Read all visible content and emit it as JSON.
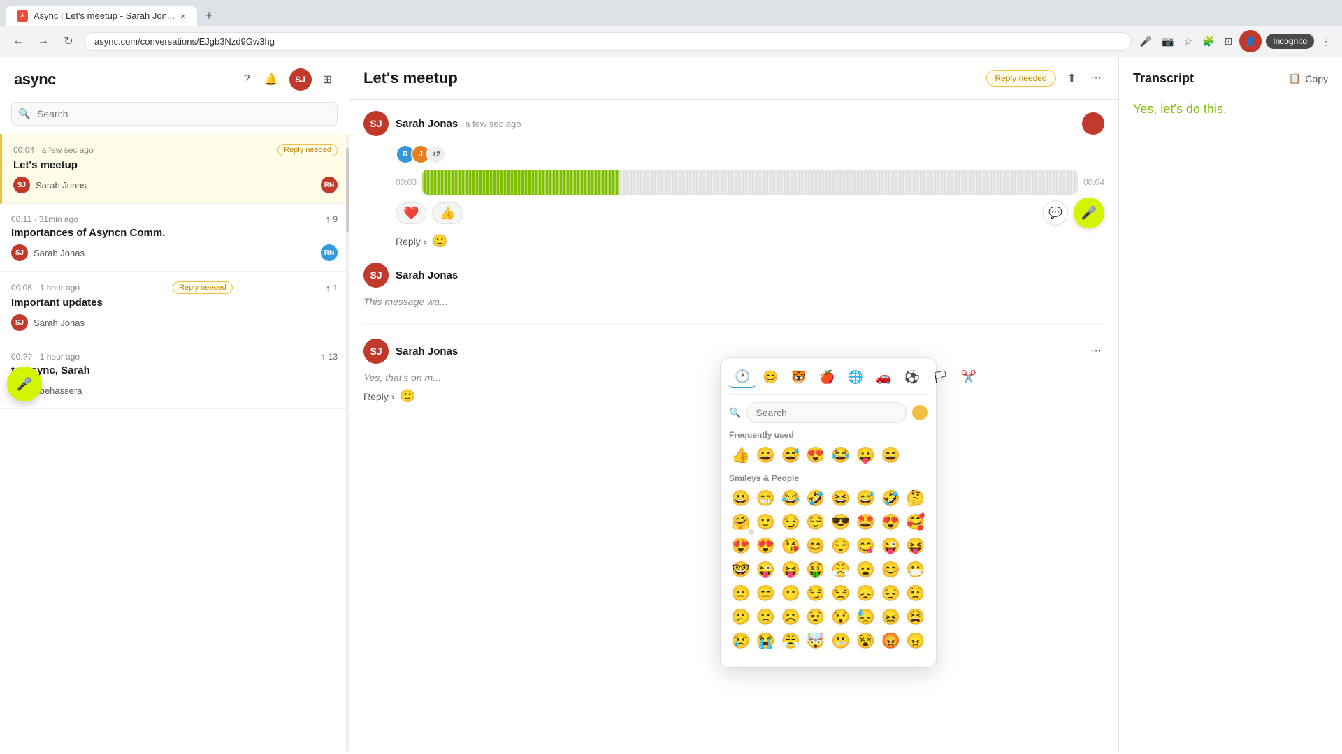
{
  "browser": {
    "tab_title": "Async | Let's meetup - Sarah Jon...",
    "tab_close": "×",
    "new_tab": "+",
    "back": "←",
    "forward": "→",
    "refresh": "↻",
    "address": "async.com/conversations/EJgb3Nzd9Gw3hg",
    "incognito": "Incognito"
  },
  "sidebar": {
    "logo": "async",
    "search_placeholder": "Search",
    "conversations": [
      {
        "id": "conv1",
        "time": "00:04 · a few sec ago",
        "badge": "Reply needed",
        "badge_type": "reply",
        "title": "Let's meetup",
        "author": "Sarah Jonas",
        "author_initials": "SJ",
        "user_badge": "RN",
        "active": true
      },
      {
        "id": "conv2",
        "time": "00:11 · 31min ago",
        "badge": "9",
        "badge_type": "vote",
        "title": "Importances of Asyncn Comm.",
        "author": "Sarah Jonas",
        "author_initials": "SJ",
        "user_badge": "RN",
        "active": false
      },
      {
        "id": "conv3",
        "time": "00:06 · 1 hour ago",
        "badge": "Reply needed",
        "badge_type": "reply",
        "badge2": "1",
        "title": "Important updates",
        "author": "Sarah Jonas",
        "author_initials": "SJ",
        "user_badge": "",
        "active": false
      },
      {
        "id": "conv4",
        "time": "00:?? · 1 hour ago",
        "badge": "13",
        "badge_type": "vote",
        "title": "to Async, Sarah",
        "author": "Abehassera",
        "author_initials": "A",
        "user_badge": "",
        "active": false
      }
    ]
  },
  "conversation": {
    "title": "Let's meetup",
    "reply_needed": "Reply needed",
    "author": "Sarah Jonas",
    "time": "a few sec ago",
    "avatar_initials": "SJ",
    "timestamps": {
      "left": "00:03",
      "right": "00:04"
    },
    "reactions": {
      "heart": "❤️",
      "thumbsup": "👍"
    },
    "avatar_stack": [
      "+2"
    ],
    "messages": [
      {
        "author": "Sarah Jonas",
        "initials": "SJ",
        "text": "This message wa...",
        "is_italic": true
      },
      {
        "author": "Sarah Jonas",
        "initials": "SJ",
        "text": "Yes, that's on m...",
        "is_italic": false
      }
    ]
  },
  "reply_button": "Reply",
  "emoji_picker": {
    "search_placeholder": "Search",
    "sections": {
      "frequently_used": "Frequently used",
      "smileys_people": "Smileys & People"
    },
    "frequently_used_emojis": [
      "👍",
      "😀",
      "😅",
      "😍",
      "😂",
      "😛",
      "😄"
    ],
    "smileys_row1": [
      "😀",
      "😁",
      "😂",
      "🤣",
      "😆",
      "😅",
      "🤣"
    ],
    "smileys_row2": [
      "🤗",
      "🙂",
      "😏",
      "😌",
      "😎",
      "🤩",
      "😍"
    ],
    "smileys_row3": [
      "😍",
      "😍",
      "😘",
      "😊",
      "😌",
      "😋",
      "😜"
    ],
    "smileys_row4": [
      "🤓",
      "😜",
      "😝",
      "🤑",
      "😤",
      "😦",
      "😊"
    ],
    "smileys_row5": [
      "😐",
      "😑",
      "😶",
      "😏",
      "😒",
      "😞",
      "😔"
    ],
    "smileys_row6": [
      "😕",
      "🙁",
      "☹️",
      "😟",
      "😯",
      "😓",
      "😖"
    ],
    "smileys_row7": [
      "😢",
      "😭",
      "😤",
      "🤯",
      "😬",
      "😵",
      "😡"
    ],
    "tabs": [
      "🕐",
      "😊",
      "🐯",
      "🍎",
      "🌐",
      "🚗",
      "⚽",
      "🏳",
      "✂️"
    ]
  },
  "transcript": {
    "title": "Transcript",
    "copy": "Copy",
    "text": "Yes, let's do this."
  }
}
